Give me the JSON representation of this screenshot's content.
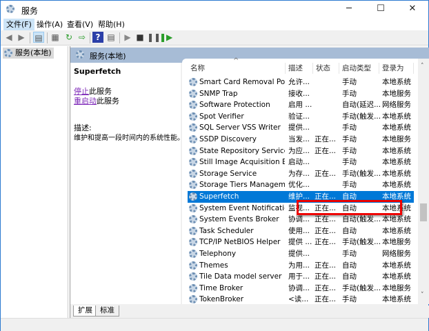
{
  "window": {
    "title": "服务",
    "minimize": "─",
    "maximize": "☐",
    "close": "✕"
  },
  "menu": [
    {
      "label": "文件(F)"
    },
    {
      "label": "操作(A)"
    },
    {
      "label": "查看(V)"
    },
    {
      "label": "帮助(H)"
    }
  ],
  "toolbar": {
    "icons": [
      "back-icon",
      "forward-icon",
      "show-tree-icon",
      "properties-icon",
      "refresh-icon",
      "export-icon",
      "help-icon",
      "console-icon",
      "play-icon",
      "stop-icon",
      "pause-icon",
      "restart-icon"
    ]
  },
  "tree": {
    "root": "服务(本地)"
  },
  "panel": {
    "header": "服务(本地)"
  },
  "details": {
    "service_name": "Superfetch",
    "stop_link": "停止",
    "stop_suffix": "此服务",
    "restart_link": "重启动",
    "restart_suffix": "此服务",
    "desc_label": "描述:",
    "description": "维护和提高一段时间内的系统性能。"
  },
  "columns": [
    "名称",
    "描述",
    "状态",
    "启动类型",
    "登录为"
  ],
  "services": [
    {
      "name": "Smart Card Removal Poli...",
      "desc": "允许...",
      "status": "",
      "startup": "手动",
      "logon": "本地系统"
    },
    {
      "name": "SNMP Trap",
      "desc": "接收...",
      "status": "",
      "startup": "手动",
      "logon": "本地服务"
    },
    {
      "name": "Software Protection",
      "desc": "启用 ...",
      "status": "",
      "startup": "自动(延迟...",
      "logon": "网络服务"
    },
    {
      "name": "Spot Verifier",
      "desc": "验证...",
      "status": "",
      "startup": "手动(触发...",
      "logon": "本地系统"
    },
    {
      "name": "SQL Server VSS Writer",
      "desc": "提供...",
      "status": "",
      "startup": "手动",
      "logon": "本地系统"
    },
    {
      "name": "SSDP Discovery",
      "desc": "当发...",
      "status": "正在...",
      "startup": "手动",
      "logon": "本地服务"
    },
    {
      "name": "State Repository Service",
      "desc": "为应...",
      "status": "正在...",
      "startup": "手动",
      "logon": "本地系统"
    },
    {
      "name": "Still Image Acquisition Ev...",
      "desc": "启动...",
      "status": "",
      "startup": "手动",
      "logon": "本地系统"
    },
    {
      "name": "Storage Service",
      "desc": "为存...",
      "status": "正在...",
      "startup": "手动(触发...",
      "logon": "本地系统"
    },
    {
      "name": "Storage Tiers Managem...",
      "desc": "优化...",
      "status": "",
      "startup": "手动",
      "logon": "本地系统"
    },
    {
      "name": "Superfetch",
      "desc": "维护...",
      "status": "正在...",
      "startup": "自动",
      "logon": "本地系统",
      "selected": true
    },
    {
      "name": "System Event Notification...",
      "desc": "监视...",
      "status": "正在...",
      "startup": "自动",
      "logon": "本地系统"
    },
    {
      "name": "System Events Broker",
      "desc": "协调...",
      "status": "正在...",
      "startup": "自动(触发...",
      "logon": "本地系统"
    },
    {
      "name": "Task Scheduler",
      "desc": "使用...",
      "status": "正在...",
      "startup": "自动",
      "logon": "本地系统"
    },
    {
      "name": "TCP/IP NetBIOS Helper",
      "desc": "提供 ...",
      "status": "正在...",
      "startup": "手动(触发...",
      "logon": "本地服务"
    },
    {
      "name": "Telephony",
      "desc": "提供...",
      "status": "",
      "startup": "手动",
      "logon": "网络服务"
    },
    {
      "name": "Themes",
      "desc": "为用...",
      "status": "正在...",
      "startup": "自动",
      "logon": "本地系统"
    },
    {
      "name": "Tile Data model server",
      "desc": "用于...",
      "status": "正在...",
      "startup": "自动",
      "logon": "本地系统"
    },
    {
      "name": "Time Broker",
      "desc": "协调...",
      "status": "正在...",
      "startup": "手动(触发...",
      "logon": "本地服务"
    },
    {
      "name": "TokenBroker",
      "desc": "<读...",
      "status": "正在...",
      "startup": "手动",
      "logon": "本地系统"
    }
  ],
  "tabs": [
    {
      "label": "扩展",
      "active": true
    },
    {
      "label": "标准"
    }
  ],
  "colors": {
    "selection": "#0078d7",
    "highlight_box": "#e00000",
    "panel_header": "#a7bcd6",
    "link": "#7d27b8"
  }
}
